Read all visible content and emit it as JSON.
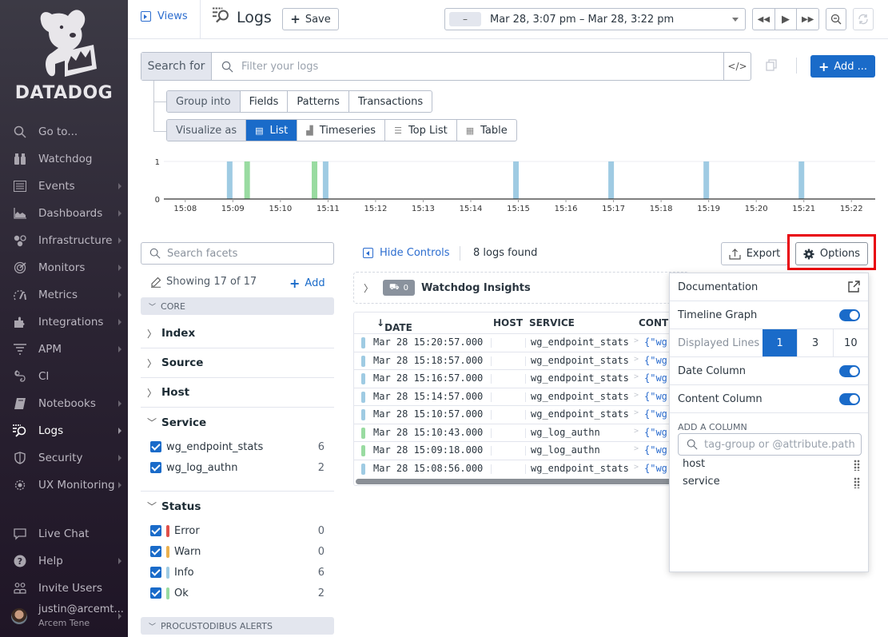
{
  "sidebar": {
    "brand": "DATADOG",
    "items": [
      {
        "label": "Go to...",
        "icon": "search-icon",
        "arrow": false
      },
      {
        "label": "Watchdog",
        "icon": "binoculars-icon",
        "arrow": false
      },
      {
        "label": "Events",
        "icon": "events-icon",
        "arrow": true
      },
      {
        "label": "Dashboards",
        "icon": "dashboard-icon",
        "arrow": true
      },
      {
        "label": "Infrastructure",
        "icon": "infrastructure-icon",
        "arrow": true
      },
      {
        "label": "Monitors",
        "icon": "monitor-icon",
        "arrow": true
      },
      {
        "label": "Metrics",
        "icon": "metrics-icon",
        "arrow": true
      },
      {
        "label": "Integrations",
        "icon": "puzzle-icon",
        "arrow": true
      },
      {
        "label": "APM",
        "icon": "apm-icon",
        "arrow": true
      },
      {
        "label": "CI",
        "icon": "ci-icon",
        "arrow": false
      },
      {
        "label": "Notebooks",
        "icon": "notebook-icon",
        "arrow": true
      },
      {
        "label": "Logs",
        "icon": "logs-icon",
        "arrow": true,
        "active": true
      },
      {
        "label": "Security",
        "icon": "shield-icon",
        "arrow": true
      },
      {
        "label": "UX Monitoring",
        "icon": "ux-monitoring-icon",
        "arrow": true
      }
    ],
    "bottom_items": [
      {
        "label": "Live Chat",
        "icon": "chat-icon",
        "arrow": false
      },
      {
        "label": "Help",
        "icon": "help-icon",
        "arrow": true
      },
      {
        "label": "Invite Users",
        "icon": "invite-users-icon",
        "arrow": false
      }
    ],
    "user": {
      "email": "justin@arcemt...",
      "org": "Arcem Tene"
    }
  },
  "topbar": {
    "views_label": "Views",
    "title": "Logs",
    "save_label": "Save",
    "time_preset": "–",
    "time_range": "Mar 28, 3:07 pm – Mar 28, 3:22 pm"
  },
  "search": {
    "label": "Search for",
    "placeholder": "Filter your logs",
    "code_label": "</>",
    "add_label": "Add ..."
  },
  "group_into": {
    "label": "Group into",
    "options": [
      "Fields",
      "Patterns",
      "Transactions"
    ]
  },
  "visualize_as": {
    "label": "Visualize as",
    "options": [
      {
        "label": "List",
        "icon": "list-icon",
        "selected": true
      },
      {
        "label": "Timeseries",
        "icon": "timeseries-icon",
        "selected": false
      },
      {
        "label": "Top List",
        "icon": "toplist-icon",
        "selected": false
      },
      {
        "label": "Table",
        "icon": "table-icon",
        "selected": false
      }
    ]
  },
  "chart_data": {
    "type": "bar",
    "title": "",
    "xlabel": "",
    "ylabel": "",
    "ylim": [
      0,
      1
    ],
    "yticks": [
      0,
      1
    ],
    "xticks": [
      "15:08",
      "15:09",
      "15:10",
      "15:11",
      "15:12",
      "15:13",
      "15:14",
      "15:15",
      "15:16",
      "15:17",
      "15:18",
      "15:19",
      "15:20",
      "15:21",
      "15:22"
    ],
    "xrange_minutes": [
      7.55,
      22.5
    ],
    "series": [
      {
        "name": "Info",
        "color": "#9fcbe3",
        "points": [
          {
            "t": "15:08:56",
            "v": 1
          },
          {
            "t": "15:10:57",
            "v": 1
          },
          {
            "t": "15:14:57",
            "v": 1
          },
          {
            "t": "15:16:57",
            "v": 1
          },
          {
            "t": "15:18:57",
            "v": 1
          },
          {
            "t": "15:20:57",
            "v": 1
          }
        ]
      },
      {
        "name": "Ok",
        "color": "#99dba1",
        "points": [
          {
            "t": "15:09:18",
            "v": 1
          },
          {
            "t": "15:10:43",
            "v": 1
          }
        ]
      }
    ]
  },
  "facets": {
    "search_placeholder": "Search facets",
    "showing": "Showing 17 of 17",
    "add_label": "Add",
    "core_label": "CORE",
    "collapsed": [
      "Index",
      "Source",
      "Host"
    ],
    "service": {
      "label": "Service",
      "values": [
        {
          "name": "wg_endpoint_stats",
          "count": "6"
        },
        {
          "name": "wg_log_authn",
          "count": "2"
        }
      ]
    },
    "status": {
      "label": "Status",
      "values": [
        {
          "name": "Error",
          "count": "0",
          "color": "#e0504a"
        },
        {
          "name": "Warn",
          "count": "0",
          "color": "#ebb14f"
        },
        {
          "name": "Info",
          "count": "6",
          "color": "#9fcbe3"
        },
        {
          "name": "Ok",
          "count": "2",
          "color": "#99dba1"
        }
      ]
    },
    "alerts_label": "PROCUSTODIBUS ALERTS"
  },
  "logs": {
    "hide_controls": "Hide Controls",
    "found": "8 logs found",
    "export_label": "Export",
    "options_label": "Options",
    "watchdog_count": "0",
    "watchdog_label": "Watchdog Insights",
    "columns": [
      "DATE",
      "HOST",
      "SERVICE",
      "CONTE"
    ],
    "rows": [
      {
        "date": "Mar 28 15:20:57.000",
        "service": "wg_endpoint_stats",
        "content": "{\"wg'",
        "color": "#9fcbe3"
      },
      {
        "date": "Mar 28 15:18:57.000",
        "service": "wg_endpoint_stats",
        "content": "{\"wg'",
        "color": "#9fcbe3"
      },
      {
        "date": "Mar 28 15:16:57.000",
        "service": "wg_endpoint_stats",
        "content": "{\"wg'",
        "color": "#9fcbe3"
      },
      {
        "date": "Mar 28 15:14:57.000",
        "service": "wg_endpoint_stats",
        "content": "{\"wg'",
        "color": "#9fcbe3"
      },
      {
        "date": "Mar 28 15:10:57.000",
        "service": "wg_endpoint_stats",
        "content": "{\"wg'",
        "color": "#9fcbe3"
      },
      {
        "date": "Mar 28 15:10:43.000",
        "service": "wg_log_authn",
        "content": "{\"wg'",
        "color": "#99dba1"
      },
      {
        "date": "Mar 28 15:09:18.000",
        "service": "wg_log_authn",
        "content": "{\"wg'",
        "color": "#99dba1"
      },
      {
        "date": "Mar 28 15:08:56.000",
        "service": "wg_endpoint_stats",
        "content": "{\"wg'",
        "color": "#9fcbe3"
      }
    ]
  },
  "options_menu": {
    "documentation": "Documentation",
    "timeline_graph": "Timeline Graph",
    "timeline_graph_on": true,
    "displayed_lines_label": "Displayed Lines",
    "displayed_lines_options": [
      "1",
      "3",
      "10"
    ],
    "displayed_lines_selected": "1",
    "date_column": "Date Column",
    "date_column_on": true,
    "content_column": "Content Column",
    "content_column_on": true,
    "add_column_label": "ADD A COLUMN",
    "add_column_placeholder": "tag-group or @attribute.path",
    "columns": [
      "host",
      "service"
    ]
  }
}
